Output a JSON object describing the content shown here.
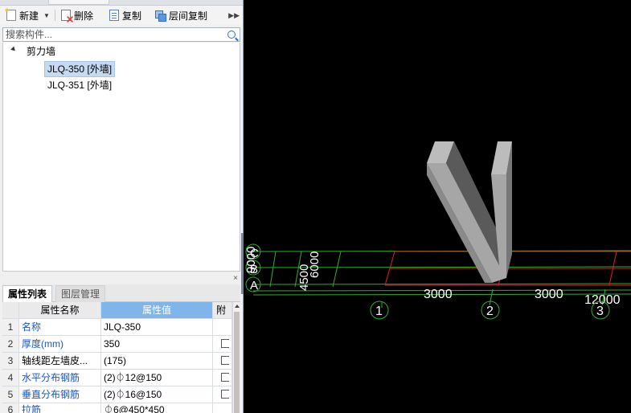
{
  "toolbar": {
    "new_label": "新建",
    "delete_label": "删除",
    "copy_label": "复制",
    "floor_copy_label": "层间复制",
    "new_icon": "new-document-icon",
    "delete_icon": "delete-icon",
    "copy_icon": "copy-icon",
    "floor_copy_icon": "floor-copy-icon",
    "more_icon": "chevron-double-right-icon"
  },
  "search": {
    "placeholder": "搜索构件...",
    "icon": "search-icon"
  },
  "tree": {
    "category": "剪力墙",
    "items": [
      {
        "label": "JLQ-350 [外墙]",
        "selected": true
      },
      {
        "label": "JLQ-351 [外墙]",
        "selected": false
      }
    ]
  },
  "properties": {
    "tabs": [
      {
        "label": "属性列表",
        "active": true
      },
      {
        "label": "图层管理",
        "active": false
      }
    ],
    "close_label": "×",
    "headers": {
      "name": "属性名称",
      "value": "属性值",
      "attach": "附"
    },
    "rows": [
      {
        "idx": "1",
        "name": "名称",
        "value": "JLQ-350",
        "name_blue": true,
        "checkbox": false
      },
      {
        "idx": "2",
        "name": "厚度(mm)",
        "value": "350",
        "name_blue": true,
        "checkbox": true
      },
      {
        "idx": "3",
        "name": "轴线距左墙皮...",
        "value": "(175)",
        "name_blue": false,
        "checkbox": true
      },
      {
        "idx": "4",
        "name": "水平分布钢筋",
        "value": "(2)⏀12@150",
        "name_blue": true,
        "checkbox": true
      },
      {
        "idx": "5",
        "name": "垂直分布钢筋",
        "value": "(2)⏀16@150",
        "name_blue": true,
        "checkbox": true
      },
      {
        "idx": "6",
        "name": "拉筋",
        "value": "⏀6@450*450",
        "name_blue": true,
        "checkbox": true
      }
    ]
  },
  "viewport": {
    "background": "#000000",
    "grid_color": "#2fae2f",
    "axis_color": "#e02020",
    "wall_color": "#a8a8a8",
    "axes_vertical": [
      "1",
      "2",
      "3"
    ],
    "axes_horizontal": [
      "C",
      "B",
      "A"
    ],
    "dimensions_x": [
      "3000",
      "3000",
      "12000"
    ],
    "dimensions_y": [
      "4500",
      "6000",
      "9000"
    ]
  }
}
